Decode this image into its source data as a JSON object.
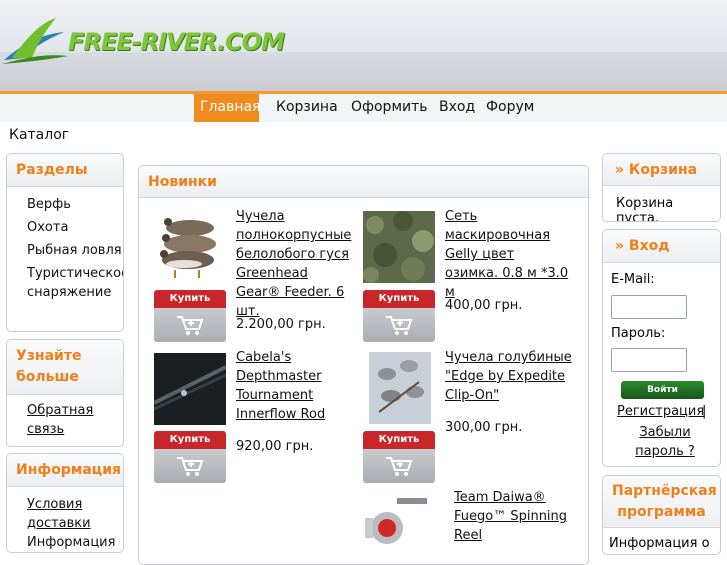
{
  "site": {
    "logo_text": "FREE-RIVER.COM"
  },
  "nav": [
    {
      "label": "Главная",
      "active": true
    },
    {
      "label": "Корзина"
    },
    {
      "label": "Оформить"
    },
    {
      "label": "Вход"
    },
    {
      "label": "Форум"
    }
  ],
  "breadcrumb": "Каталог",
  "left": {
    "sections_title": "Разделы",
    "sections": [
      "Верфь",
      "Охота",
      "Рыбная ловля",
      "Туристическое снаряжение"
    ],
    "learn_title": "Узнайте больше",
    "learn_items": [
      "Обратная связь"
    ],
    "info_title": "Информация",
    "info_items": [
      "Условия доставки",
      "Информация"
    ]
  },
  "main": {
    "title": "Новинки",
    "buy_label": "Купить",
    "products": [
      {
        "name": "Чучела полнокорпусные белолобого гуся Greenhead Gear® Feeder. 6 шт.",
        "price": "2.200,00 грн.",
        "image": "goose-decoys"
      },
      {
        "name": "Сеть маскировочная Gelly цвет озимка. 0.8 м *3.0 м",
        "price": "400,00 грн.",
        "image": "camo-net"
      },
      {
        "name": "Cabela's Depthmaster Tournament Innerflow Rod",
        "price": "920,00 грн.",
        "image": "fishing-rod"
      },
      {
        "name": "Чучела голубиные \"Edge by Expedite Clip-On\"",
        "price": "300,00 грн.",
        "image": "pigeon-decoys"
      },
      {
        "name": "Team Daiwa® Fuego™ Spinning Reel",
        "price": "",
        "image": "spinning-reel"
      }
    ]
  },
  "right": {
    "cart_title": "» Корзина",
    "cart_status": "Корзина пуста.",
    "login_title": "» Вход",
    "email_label": "E-Mail:",
    "password_label": "Пароль:",
    "login_button": "Войти",
    "register_link": "Регистрация",
    "separator": "|",
    "forgot_link": "Забыли пароль ?",
    "partner_title": "Партнёрская программа",
    "partner_text": "Информация о"
  },
  "colors": {
    "accent": "#f07f1a",
    "nav_active": "#f08c1e",
    "buy_red": "#c8262a",
    "login_green": "#1f6e1c"
  }
}
